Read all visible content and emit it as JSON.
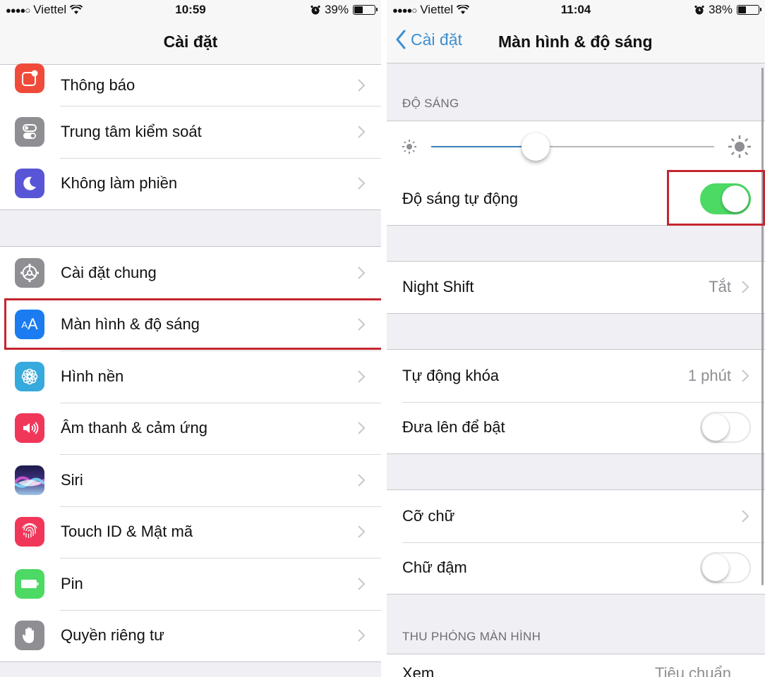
{
  "left_screen": {
    "status": {
      "carrier": "Viettel",
      "signal_dots": "●●●●○",
      "time": "10:59",
      "battery_percent": "39%",
      "battery_level": 0.39
    },
    "nav": {
      "title": "Cài đặt"
    },
    "groups": [
      {
        "items": [
          {
            "label": "Thông báo",
            "icon": "notifications-icon",
            "color": "#f04b3a"
          },
          {
            "label": "Trung tâm kiểm soát",
            "icon": "control-center-icon",
            "color": "#8e8e93"
          },
          {
            "label": "Không làm phiền",
            "icon": "moon-icon",
            "color": "#5856d6"
          }
        ]
      },
      {
        "items": [
          {
            "label": "Cài đặt chung",
            "icon": "gear-icon",
            "color": "#8e8e93"
          },
          {
            "label": "Màn hình & độ sáng",
            "icon": "display-brightness-icon",
            "color": "#1a7cf0",
            "highlighted": true
          },
          {
            "label": "Hình nền",
            "icon": "wallpaper-icon",
            "color": "#36aadc"
          },
          {
            "label": "Âm thanh & cảm ứng",
            "icon": "speaker-icon",
            "color": "#f0375a"
          },
          {
            "label": "Siri",
            "icon": "siri-icon",
            "color": "#2a2a6e"
          },
          {
            "label": "Touch ID & Mật mã",
            "icon": "fingerprint-icon",
            "color": "#f0375a"
          },
          {
            "label": "Pin",
            "icon": "battery-icon",
            "color": "#4cd964"
          },
          {
            "label": "Quyền riêng tư",
            "icon": "hand-icon",
            "color": "#8e8e93"
          }
        ]
      }
    ]
  },
  "right_screen": {
    "status": {
      "carrier": "Viettel",
      "signal_dots": "●●●●○",
      "time": "11:04",
      "battery_percent": "38%",
      "battery_level": 0.38
    },
    "nav": {
      "back_label": "Cài đặt",
      "title": "Màn hình & độ sáng"
    },
    "brightness_section": {
      "header": "ĐỘ SÁNG",
      "slider_value": 0.37,
      "auto_brightness": {
        "label": "Độ sáng tự động",
        "on": true,
        "highlighted": true
      }
    },
    "night_shift": {
      "label": "Night Shift",
      "value": "Tắt"
    },
    "lock_group": {
      "auto_lock": {
        "label": "Tự động khóa",
        "value": "1 phút"
      },
      "raise_to_wake": {
        "label": "Đưa lên để bật",
        "on": false
      }
    },
    "text_group": {
      "text_size": {
        "label": "Cỡ chữ"
      },
      "bold_text": {
        "label": "Chữ đậm",
        "on": false
      }
    },
    "zoom_section": {
      "header": "THU PHÓNG MÀN HÌNH",
      "view": {
        "label": "Xem",
        "value": "Tiêu chuẩn"
      }
    }
  },
  "colors": {
    "accent_blue": "#3d8fd1",
    "switch_on": "#4cd964",
    "highlight_red": "#c4262e",
    "group_bg": "#efeff4"
  }
}
